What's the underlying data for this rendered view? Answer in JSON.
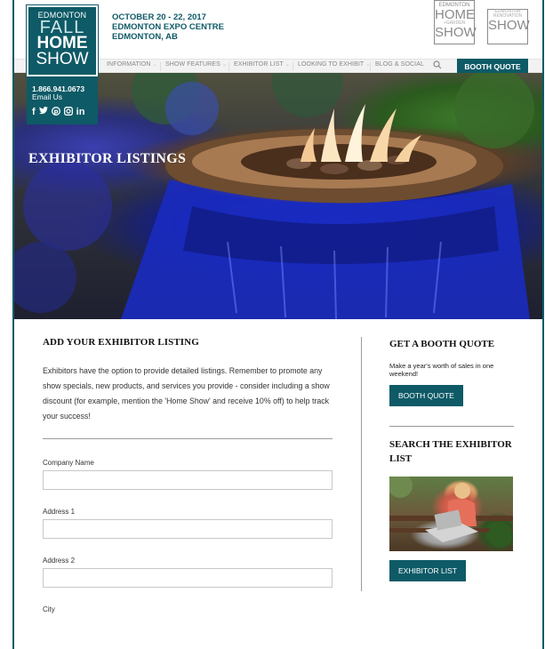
{
  "logo": {
    "line1": "EDMONTON",
    "line2": "FALL",
    "line3": "HOME",
    "line4": "SHOW"
  },
  "contact": {
    "phone": "1.866.941.0673",
    "email": "Email Us",
    "socials": [
      "facebook-icon",
      "twitter-icon",
      "pinterest-icon",
      "instagram-icon",
      "linkedin-icon"
    ]
  },
  "event": {
    "dates": "OCTOBER 20 - 22, 2017",
    "venue": "EDMONTON EXPO CENTRE",
    "city": "EDMONTON, AB"
  },
  "partners": {
    "home_garden": {
      "top": "EDMONTON",
      "home": "HOME",
      "garden": "+GARDEN",
      "show": "SHOW"
    },
    "renovation": {
      "top": "EDMONTON",
      "mid": "RENOVATION",
      "show": "SHOW"
    }
  },
  "nav": {
    "items": [
      "INFORMATION",
      "SHOW FEATURES",
      "EXHIBITOR LIST",
      "LOOKING TO EXHIBIT",
      "BLOG & SOCIAL"
    ],
    "cta": "BOOTH QUOTE"
  },
  "hero": {
    "title": "EXHIBITOR LISTINGS"
  },
  "main": {
    "heading": "ADD YOUR EXHIBITOR LISTING",
    "intro": "Exhibitors have the option to provide detailed listings. Remember to promote any show specials, new products, and services you provide - consider including a show discount (for example, mention the 'Home Show' and receive 10% off) to help track your success!",
    "fields": {
      "company_label": "Company Name",
      "address1_label": "Address 1",
      "address2_label": "Address 2",
      "city_label": "City"
    }
  },
  "sidebar": {
    "quote_heading": "GET A BOOTH QUOTE",
    "quote_text": "Make a year's worth of sales in one weekend!",
    "quote_button": "BOOTH QUOTE",
    "search_heading": "SEARCH THE EXHIBITOR LIST",
    "search_button": "EXHIBITOR LIST"
  },
  "colors": {
    "brand": "#0e5a66",
    "nav_bg": "#f2f2f2"
  }
}
